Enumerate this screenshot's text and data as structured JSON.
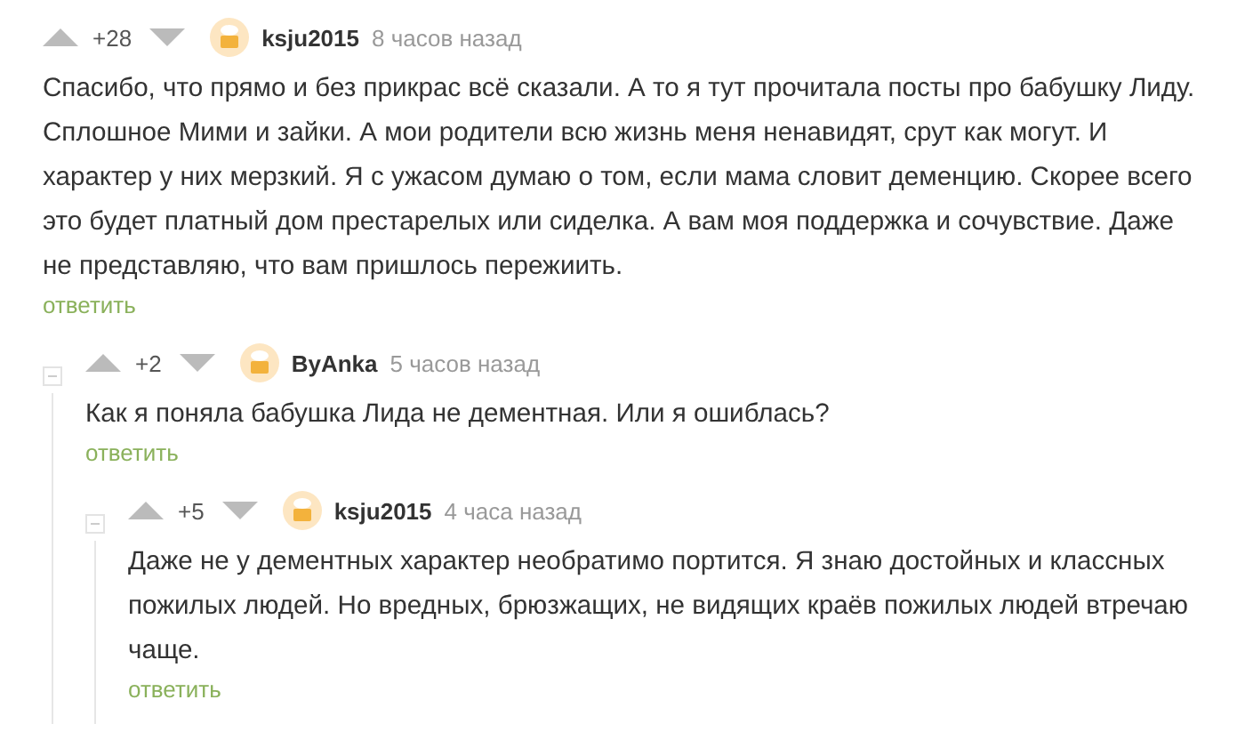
{
  "comments": [
    {
      "rating": "+28",
      "author": "ksju2015",
      "time": "8 часов назад",
      "text": "Спасибо, что прямо и без прикрас всё сказали. А то я тут прочитала посты про бабушку Лиду. Сплошное Мими и зайки. А мои родители всю жизнь меня ненавидят, срут как могут. И характер у них мерзкий. Я с ужасом думаю о том, если мама словит деменцию. Скорее всего это будет платный дом престарелых или сиделка. А вам моя поддержка и сочувствие. Даже не представляю, что вам пришлось пережиить.",
      "reply": "ответить",
      "children": [
        {
          "rating": "+2",
          "author": "ByAnka",
          "time": "5 часов назад",
          "text": "Как я поняла бабушка Лида не дементная. Или я ошиблась?",
          "reply": "ответить",
          "children": [
            {
              "rating": "+5",
              "author": "ksju2015",
              "time": "4 часа назад",
              "text": "Даже не у дементных характер необратимо портится. Я знаю достойных и классных пожилых людей. Но вредных, брюзжащих, не видящих краёв пожилых людей втречаю чаще.",
              "reply": "ответить"
            }
          ]
        }
      ]
    }
  ]
}
